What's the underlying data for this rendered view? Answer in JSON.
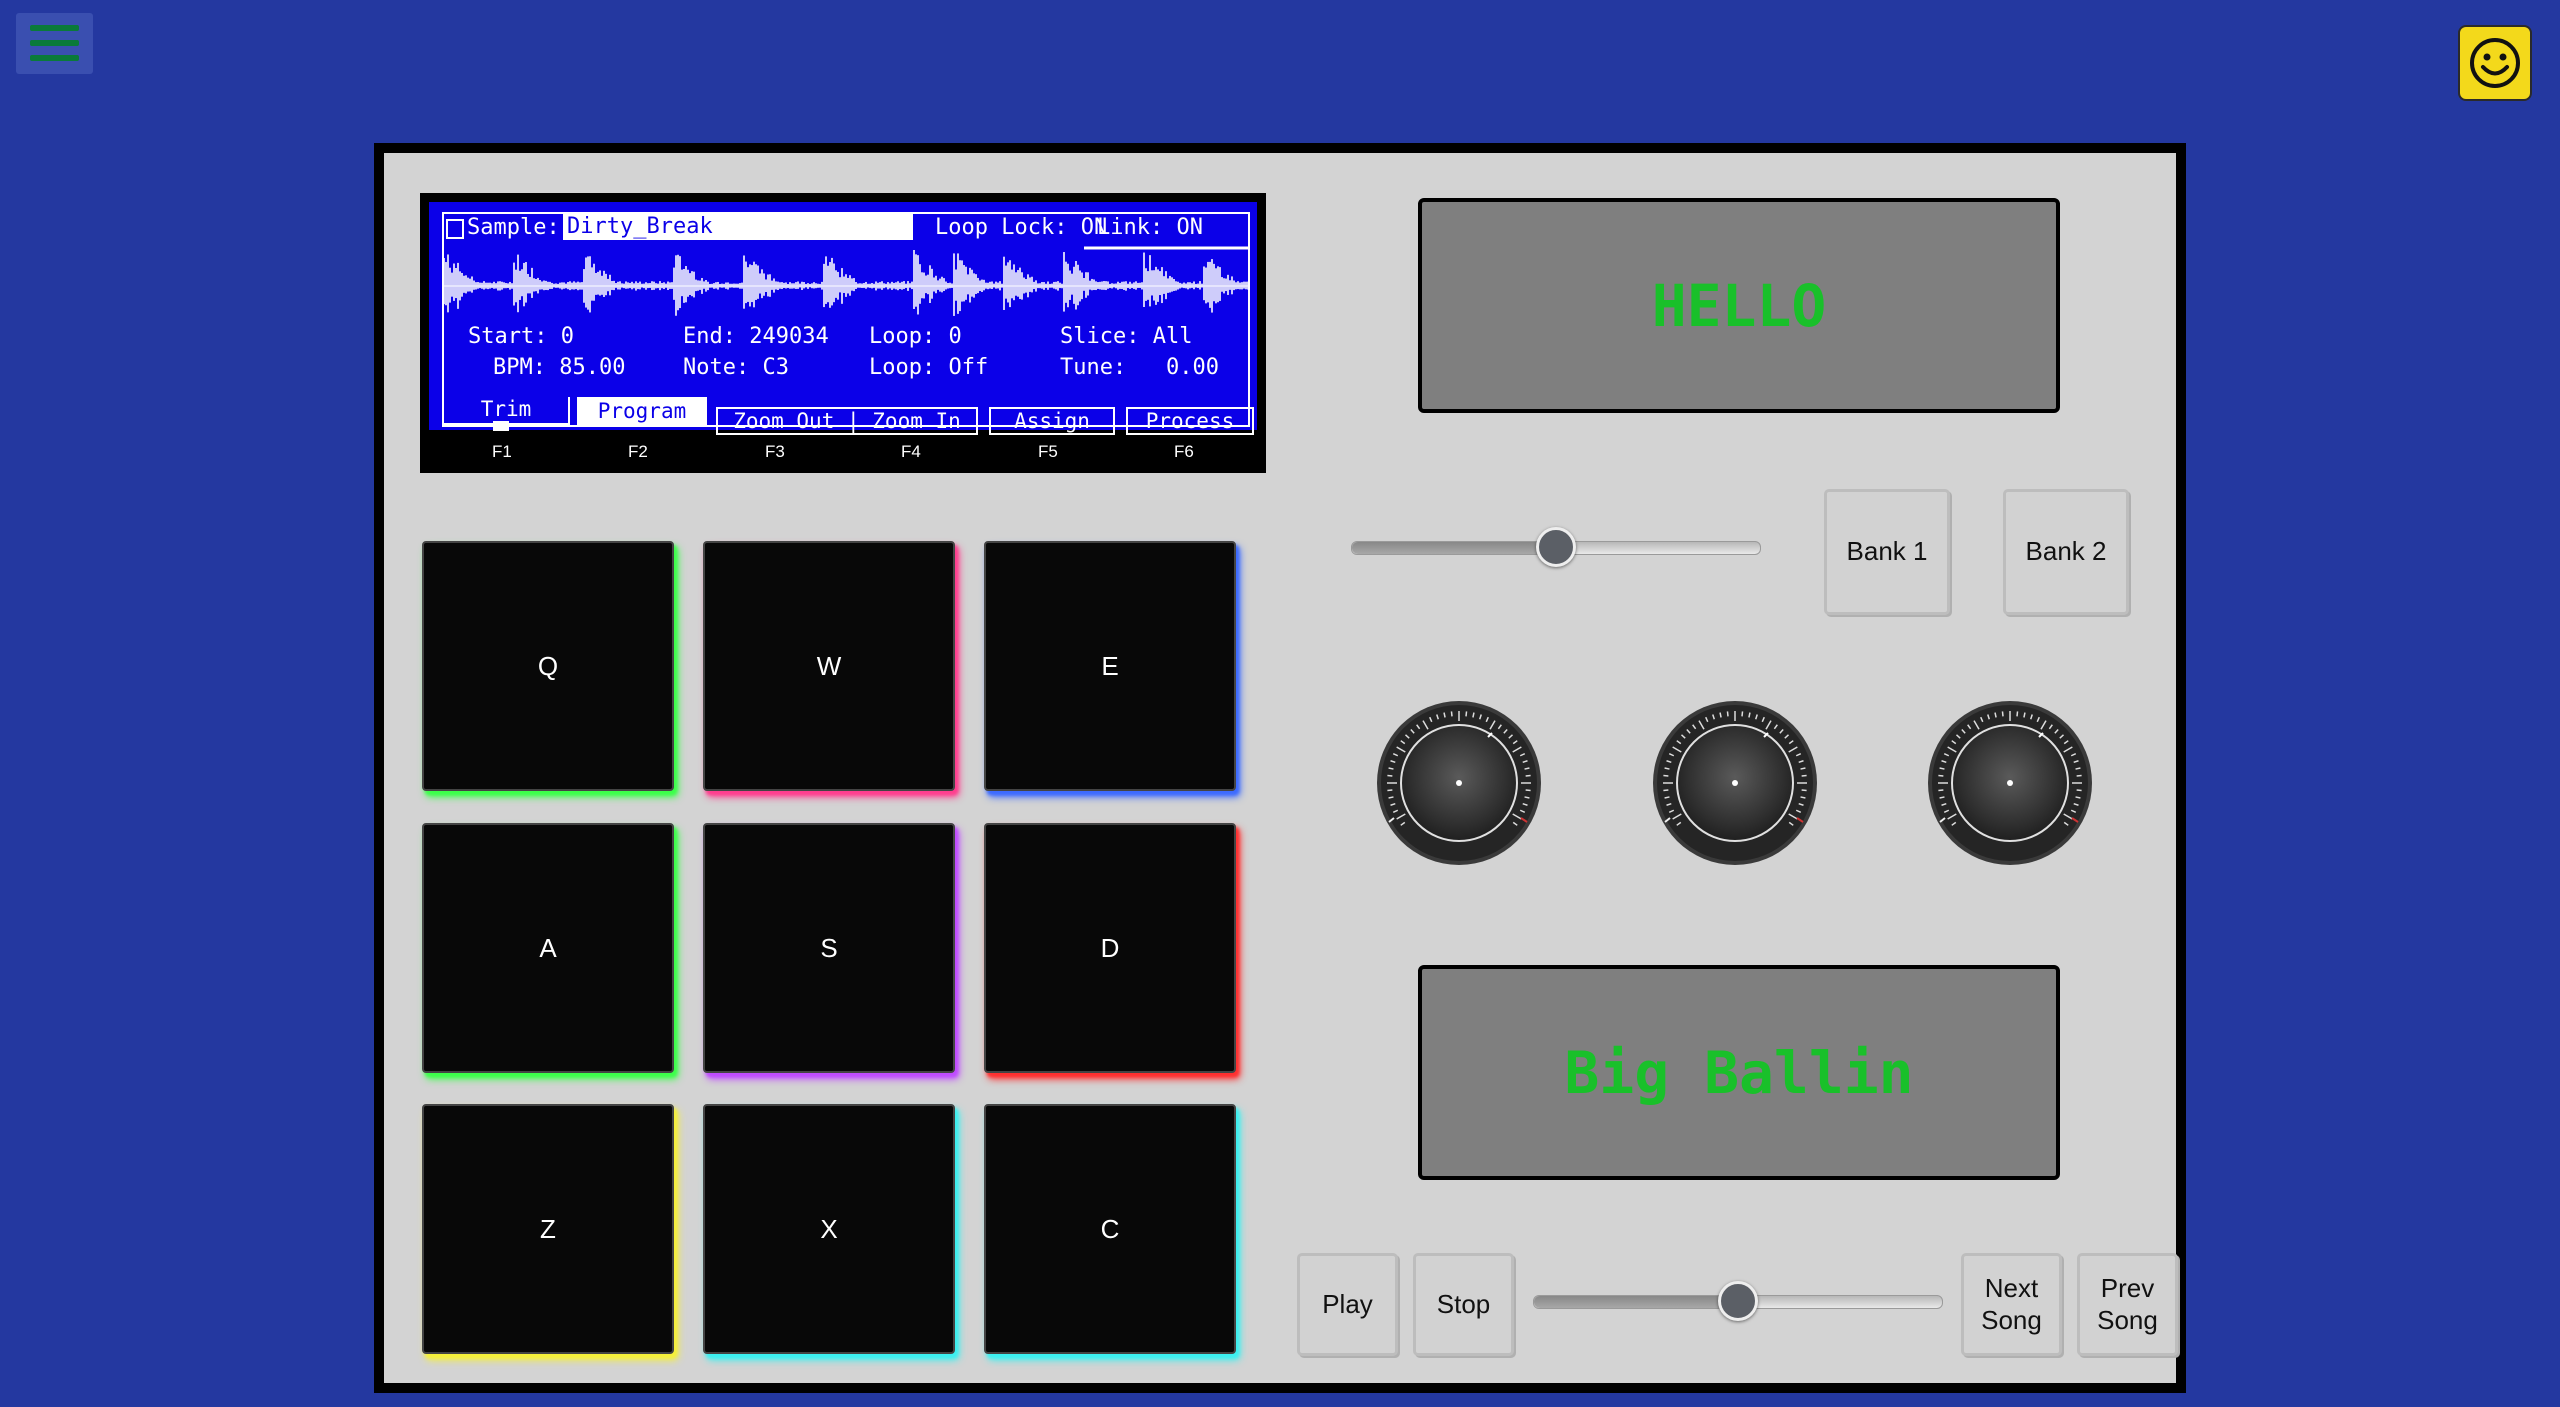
{
  "lcd": {
    "sample_label": "Sample:",
    "sample_name": "Dirty_Break",
    "loop_lock": "Loop Lock: ON",
    "link": "Link: ON",
    "start": "Start: 0",
    "end": "End: 249034",
    "loop": "Loop: 0",
    "slice": "Slice: All",
    "bpm": "BPM: 85.00",
    "note": "Note: C3",
    "loop_mode": "Loop: Off",
    "tune": "Tune:   0.00",
    "tabs": [
      "Trim",
      "Program",
      "Zoom Out | Zoom In",
      "Assign",
      "Process"
    ],
    "fkeys": [
      "F1",
      "F2",
      "F3",
      "F4",
      "F5",
      "F6"
    ]
  },
  "pads": [
    {
      "label": "Q",
      "glow": "#3cff4a"
    },
    {
      "label": "W",
      "glow": "#ff3f8f"
    },
    {
      "label": "E",
      "glow": "#3d6bff"
    },
    {
      "label": "A",
      "glow": "#3cff4a"
    },
    {
      "label": "S",
      "glow": "#c04cff"
    },
    {
      "label": "D",
      "glow": "#ff3030"
    },
    {
      "label": "Z",
      "glow": "#f5f03a"
    },
    {
      "label": "X",
      "glow": "#3cf0f0"
    },
    {
      "label": "C",
      "glow": "#3cf0f0"
    }
  ],
  "display_top": "HELLO",
  "display_bottom": "Big Ballin",
  "slider_top": {
    "value": 0.5
  },
  "slider_bottom": {
    "value": 0.5
  },
  "banks": [
    "Bank 1",
    "Bank 2"
  ],
  "transport": {
    "play": "Play",
    "stop": "Stop",
    "next_song": "Next Song",
    "prev_song": "Prev Song"
  },
  "colors": {
    "background": "#2438a0",
    "lcd_blue": "#0b00e8",
    "display_text": "#19c02a",
    "menu_icon": "#0a7a3a",
    "smiley": "#f3d91b"
  }
}
